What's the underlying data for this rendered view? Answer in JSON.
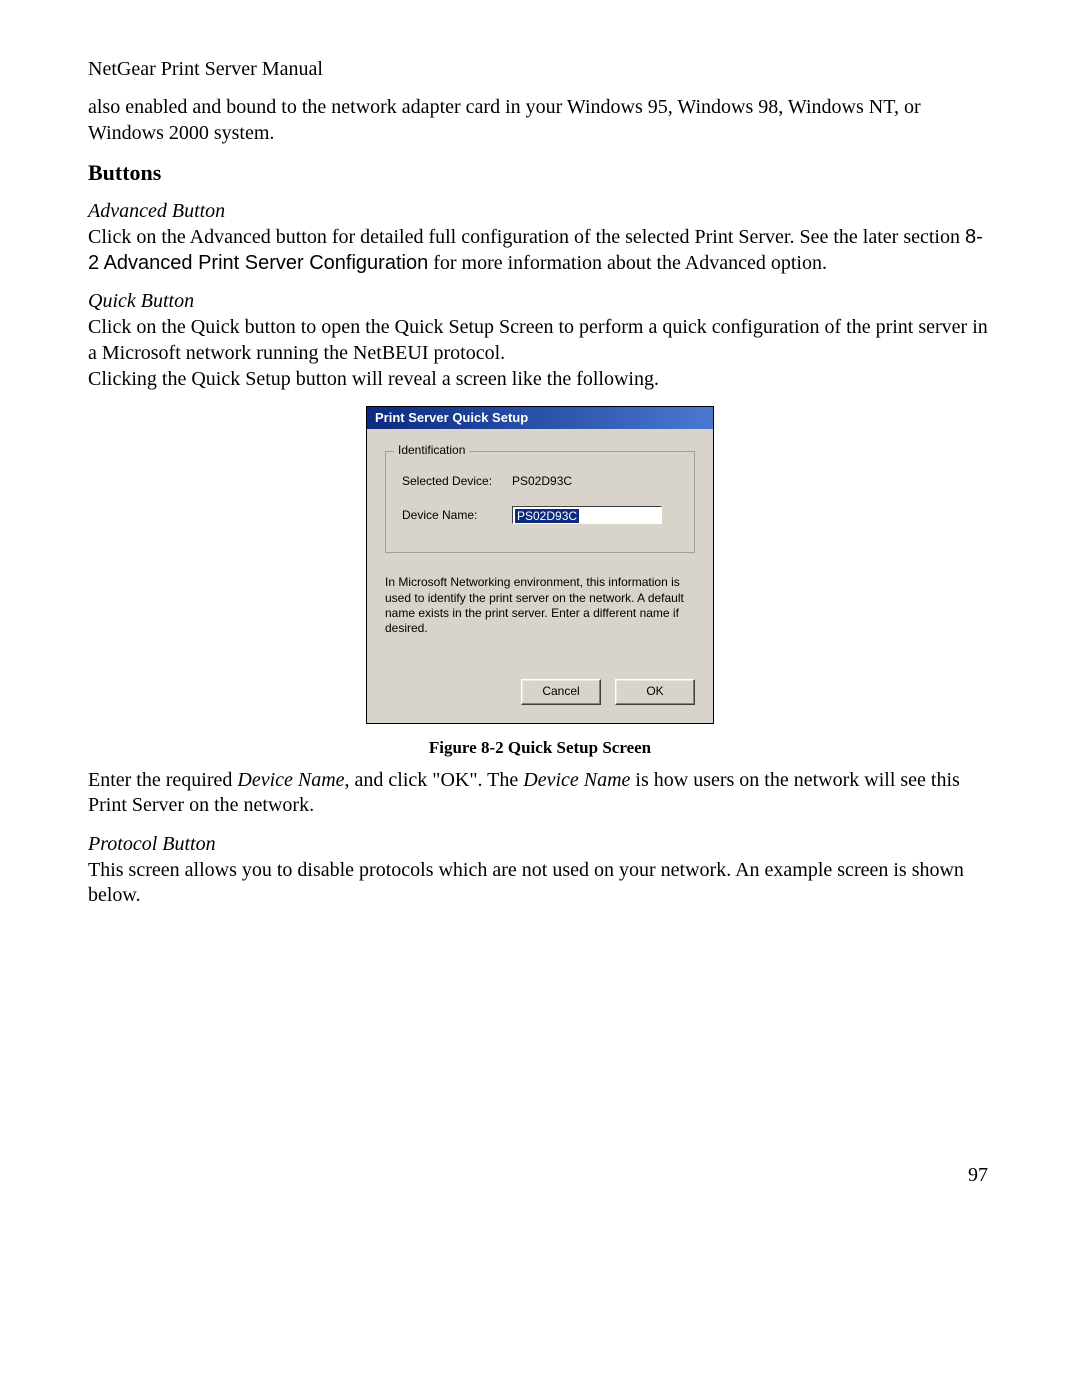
{
  "header": "NetGear Print Server Manual",
  "intro_cont": "also enabled and bound to the network adapter card in your Windows 95, Windows 98, Windows NT, or Windows 2000 system.",
  "section_heading": "Buttons",
  "advanced": {
    "heading": "Advanced Button",
    "text_before": "Click on the Advanced button for detailed full configuration of the selected Print Server. See the later section ",
    "ref": "8-2   Advanced Print Server Configuration",
    "text_after": " for more information about the Advanced option."
  },
  "quick": {
    "heading": "Quick Button",
    "p1": "Click on the Quick button to open the Quick Setup Screen to perform a quick configuration of the print server in a Microsoft network running the NetBEUI protocol.",
    "p2": "Clicking the Quick Setup button will reveal a screen like the following."
  },
  "dialog": {
    "title": "Print Server Quick Setup",
    "group": "Identification",
    "selected_label": "Selected Device:",
    "selected_value": "PS02D93C",
    "name_label": "Device Name:",
    "name_value": "PS02D93C",
    "info": "In Microsoft Networking environment, this information is used to identify the print server on the network.  A default name exists in the print server.  Enter a different name if desired.",
    "cancel": "Cancel",
    "ok": "OK"
  },
  "figure_caption": "Figure 8-2 Quick Setup Screen",
  "after_fig": {
    "a": "Enter the required ",
    "b": "Device Name",
    "c": ", and click \"OK\". The ",
    "d": "Device Name",
    "e": " is how users on the network will see this Print Server on the network."
  },
  "protocol": {
    "heading": "Protocol Button",
    "p": "This screen allows you to disable protocols which are not used on your network. An example screen is shown below."
  },
  "page_number": "97"
}
